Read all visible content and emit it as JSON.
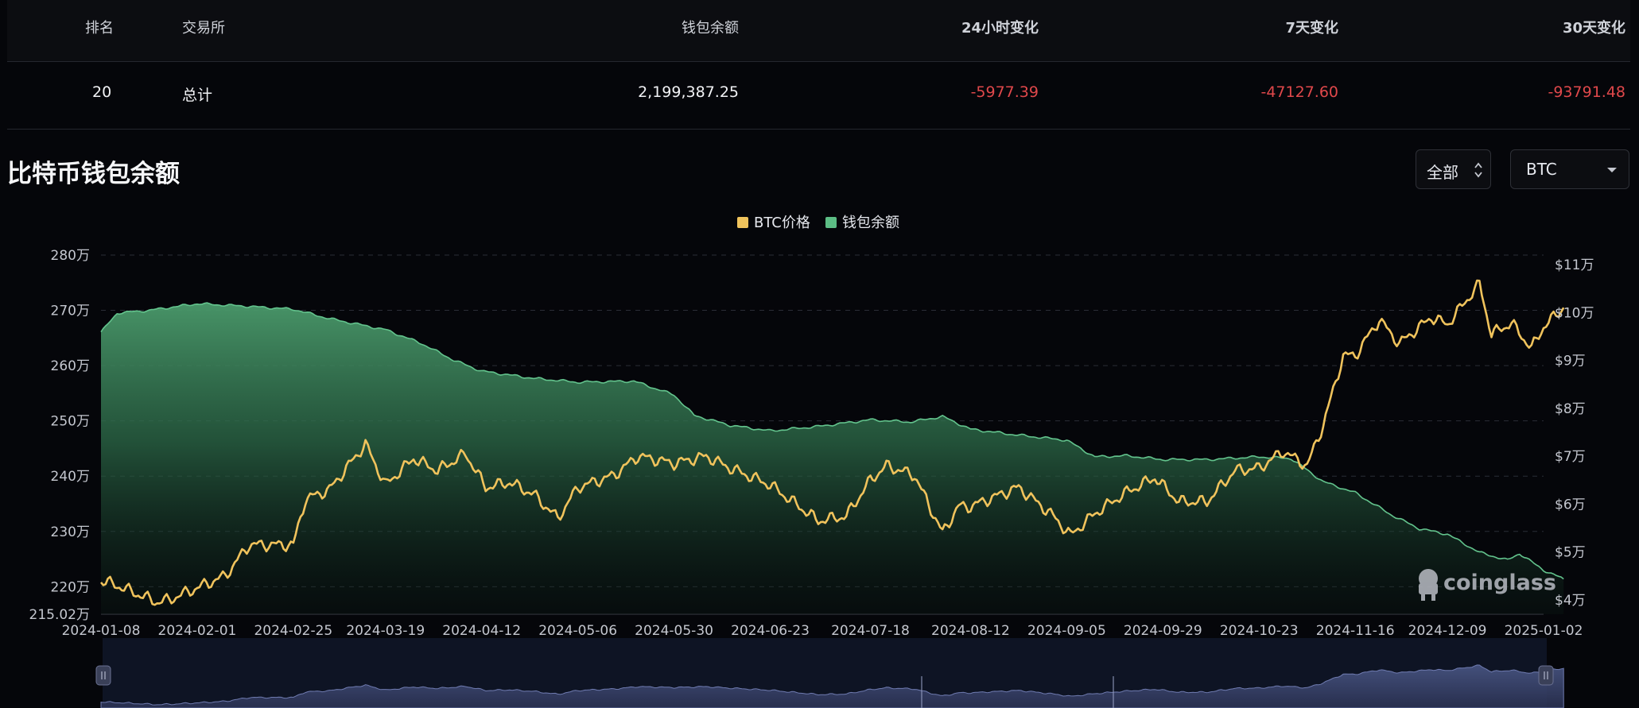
{
  "table": {
    "headers": {
      "rank": "排名",
      "exchange": "交易所",
      "balance": "钱包余额",
      "change_24h": "24小时变化",
      "change_7d": "7天变化",
      "change_30d": "30天变化"
    },
    "total_row": {
      "rank": "20",
      "exchange": "总计",
      "balance": "2,199,387.25",
      "change_24h": "-5977.39",
      "change_7d": "-47127.60",
      "change_30d": "-93791.48"
    }
  },
  "section_title": "比特币钱包余额",
  "controls": {
    "range": "全部",
    "coin": "BTC"
  },
  "watermark": "coinglass",
  "colors": {
    "price": "#f0c35c",
    "balance": "#5cbd85",
    "negative": "#e0484b",
    "background": "#05060a"
  },
  "chart_data": {
    "type": "area",
    "legend": [
      "BTC价格",
      "钱包余额"
    ],
    "legend_position": "top-center",
    "grid": true,
    "x_ticks": [
      "2024-01-08",
      "2024-02-01",
      "2024-02-25",
      "2024-03-19",
      "2024-04-12",
      "2024-05-06",
      "2024-05-30",
      "2024-06-23",
      "2024-07-18",
      "2024-08-12",
      "2024-09-05",
      "2024-09-29",
      "2024-10-23",
      "2024-11-16",
      "2024-12-09",
      "2025-01-02"
    ],
    "left_axis": {
      "ticks": [
        "280万",
        "270万",
        "260万",
        "250万",
        "240万",
        "230万",
        "220万",
        "215.02万"
      ],
      "min_label": "215.02万",
      "range": [
        2150200,
        2800000
      ]
    },
    "right_axis": {
      "ticks": [
        "$11万",
        "$10万",
        "$9万",
        "$8万",
        "$7万",
        "$6万",
        "$5万",
        "$4万"
      ],
      "range": [
        35000,
        110000
      ]
    },
    "series": [
      {
        "name": "钱包余额",
        "axis": "left",
        "x": [
          "2024-01-08",
          "2024-01-12",
          "2024-01-20",
          "2024-02-01",
          "2024-02-12",
          "2024-02-25",
          "2024-03-05",
          "2024-03-19",
          "2024-03-28",
          "2024-04-05",
          "2024-04-12",
          "2024-04-25",
          "2024-05-06",
          "2024-05-20",
          "2024-05-30",
          "2024-06-04",
          "2024-06-13",
          "2024-06-23",
          "2024-07-05",
          "2024-07-18",
          "2024-07-28",
          "2024-08-05",
          "2024-08-12",
          "2024-08-23",
          "2024-09-05",
          "2024-09-12",
          "2024-09-20",
          "2024-09-29",
          "2024-10-10",
          "2024-10-23",
          "2024-10-31",
          "2024-11-08",
          "2024-11-16",
          "2024-11-25",
          "2024-12-02",
          "2024-12-09",
          "2024-12-17",
          "2024-12-24",
          "2024-12-27",
          "2025-01-02",
          "2025-01-07"
        ],
        "values": [
          2660000,
          2695000,
          2700000,
          2712000,
          2708000,
          2702000,
          2685000,
          2665000,
          2640000,
          2610000,
          2590000,
          2577000,
          2570000,
          2572000,
          2547000,
          2510000,
          2492000,
          2482000,
          2490000,
          2502000,
          2498000,
          2508000,
          2485000,
          2475000,
          2465000,
          2435000,
          2437000,
          2430000,
          2430000,
          2435000,
          2432000,
          2390000,
          2370000,
          2330000,
          2305000,
          2295000,
          2262000,
          2248000,
          2260000,
          2230000,
          2214000
        ]
      },
      {
        "name": "BTC价格",
        "axis": "right",
        "x": [
          "2024-01-08",
          "2024-01-12",
          "2024-01-22",
          "2024-01-25",
          "2024-02-01",
          "2024-02-08",
          "2024-02-14",
          "2024-02-25",
          "2024-02-28",
          "2024-03-05",
          "2024-03-14",
          "2024-03-19",
          "2024-03-26",
          "2024-04-01",
          "2024-04-08",
          "2024-04-13",
          "2024-04-19",
          "2024-04-25",
          "2024-05-01",
          "2024-05-06",
          "2024-05-15",
          "2024-05-21",
          "2024-05-30",
          "2024-06-07",
          "2024-06-13",
          "2024-06-23",
          "2024-07-05",
          "2024-07-12",
          "2024-07-18",
          "2024-07-22",
          "2024-07-29",
          "2024-08-05",
          "2024-08-09",
          "2024-08-12",
          "2024-08-24",
          "2024-09-01",
          "2024-09-06",
          "2024-09-12",
          "2024-09-20",
          "2024-09-27",
          "2024-10-03",
          "2024-10-10",
          "2024-10-17",
          "2024-10-23",
          "2024-10-29",
          "2024-11-04",
          "2024-11-08",
          "2024-11-13",
          "2024-11-16",
          "2024-11-22",
          "2024-11-27",
          "2024-12-05",
          "2024-12-09",
          "2024-12-17",
          "2024-12-20",
          "2024-12-25",
          "2024-12-30",
          "2025-01-02",
          "2025-01-07"
        ],
        "values": [
          44000,
          43000,
          39500,
          40000,
          42500,
          45000,
          51500,
          51500,
          61000,
          63000,
          72500,
          64000,
          69500,
          67000,
          70500,
          63500,
          64500,
          62000,
          57000,
          63500,
          66000,
          70000,
          68500,
          70000,
          67500,
          64000,
          56500,
          57500,
          65000,
          68000,
          66000,
          54000,
          59500,
          59500,
          63500,
          58000,
          53500,
          58000,
          62500,
          65500,
          60500,
          60500,
          67000,
          67500,
          71000,
          68000,
          76500,
          91000,
          91000,
          98500,
          93500,
          99000,
          97500,
          106000,
          95500,
          97800,
          92500,
          97000,
          101000
        ]
      }
    ]
  }
}
